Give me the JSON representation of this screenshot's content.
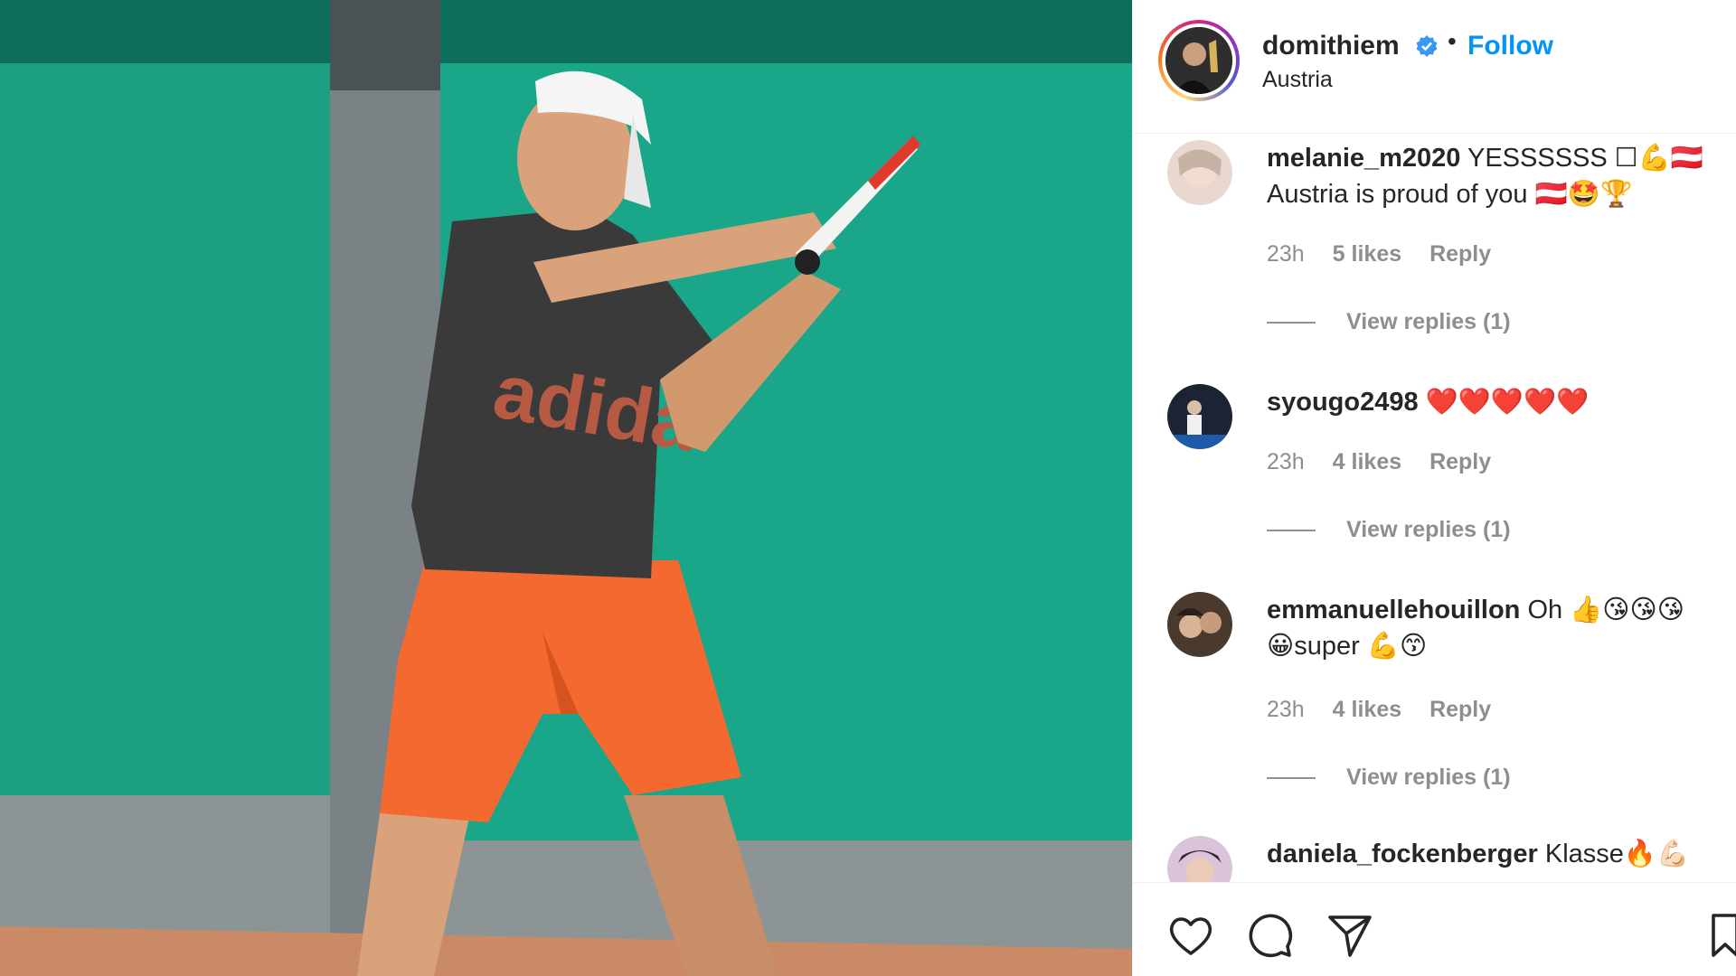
{
  "post": {
    "username": "domithiem",
    "follow_label": "Follow",
    "separator": "•",
    "location": "Austria",
    "verified_icon": "verified-badge-icon",
    "accent_color": "#0095f6"
  },
  "comments": [
    {
      "username": "melanie_m2020",
      "text": "YESSSSSS ☐💪🇦🇹 Austria is proud of you 🇦🇹🤩🏆",
      "time": "23h",
      "likes": "5 likes",
      "reply_label": "Reply",
      "view_replies": "View replies (1)"
    },
    {
      "username": "syougo2498",
      "text": "❤️❤️❤️❤️❤️",
      "time": "23h",
      "likes": "4 likes",
      "reply_label": "Reply",
      "view_replies": "View replies (1)"
    },
    {
      "username": "emmanuellehouillon",
      "text": "Oh 👍😘😘😘 😀super 💪😙",
      "time": "23h",
      "likes": "4 likes",
      "reply_label": "Reply",
      "view_replies": "View replies (1)"
    },
    {
      "username": "daniela_fockenberger",
      "text": "Klasse🔥💪🏻"
    }
  ],
  "actions": {
    "like_icon": "heart-icon",
    "comment_icon": "comment-bubble-icon",
    "share_icon": "paper-plane-icon",
    "save_icon": "bookmark-icon"
  }
}
